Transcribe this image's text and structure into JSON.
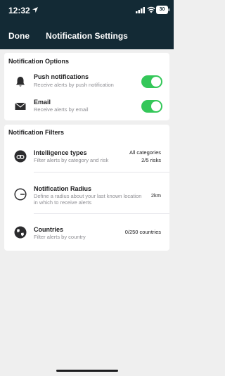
{
  "status_bar": {
    "time": "12:32",
    "battery": "30"
  },
  "header": {
    "done_label": "Done",
    "title": "Notification Settings"
  },
  "options": {
    "title": "Notification Options",
    "items": [
      {
        "title": "Push notifications",
        "subtitle": "Receive alerts by push notification",
        "icon": "bell-icon",
        "enabled": true
      },
      {
        "title": "Email",
        "subtitle": "Receive alerts by email",
        "icon": "envelope-icon",
        "enabled": true
      }
    ]
  },
  "filters": {
    "title": "Notification Filters",
    "items": [
      {
        "title": "Intelligence types",
        "subtitle": "Filter alerts by category and risk",
        "value_line1": "All categories",
        "value_line2": "2/5 risks",
        "icon": "binoculars-icon"
      },
      {
        "title": "Notification Radius",
        "subtitle_line1": "Define a radius about your last known location",
        "subtitle_line2": "in which to receive alerts",
        "value": "2km",
        "icon": "radius-icon"
      },
      {
        "title": "Countries",
        "subtitle": "Filter alerts by country",
        "value": "0/250 countries",
        "icon": "globe-icon"
      }
    ]
  },
  "colors": {
    "header_bg": "#132a35",
    "toggle_on": "#34c759",
    "background": "#efefef"
  }
}
